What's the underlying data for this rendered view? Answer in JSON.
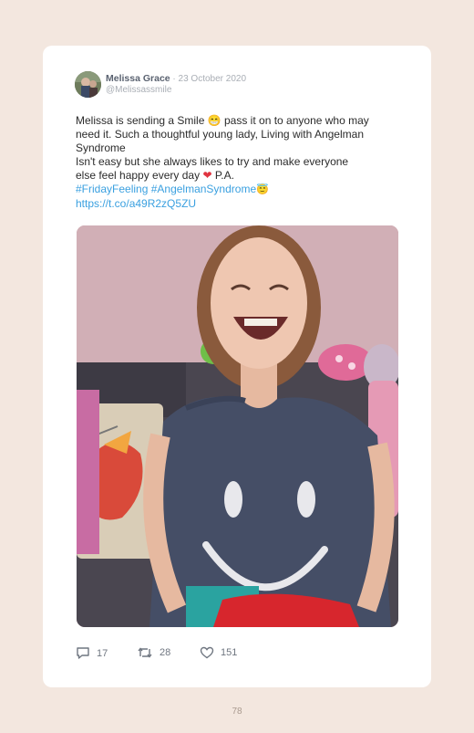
{
  "tweet": {
    "author_name": "Melissa Grace",
    "separator": " · ",
    "date": "23 October 2020",
    "handle": "@Melissassmile",
    "text_lines": [
      "Melissa is sending a Smile 😁 pass it on to anyone who may",
      "need it. Such a thoughtful young lady, Living with Angelman",
      "Syndrome",
      "Isn't easy but she always likes to try and make everyone",
      "else feel happy every day"
    ],
    "heart_emoji": "❤",
    "signature": " P.A.",
    "hashtag_1": "#FridayFeeling",
    "hashtag_2": "#AngelmanSyndrome",
    "hashtag_emoji": "😇",
    "link": "https://t.co/a49R2zQ5ZU"
  },
  "actions": {
    "replies": "17",
    "retweets": "28",
    "likes": "151",
    "reply_icon": "speech-bubble-icon",
    "retweet_icon": "retweet-arrows-icon",
    "like_icon": "heart-outline-icon"
  },
  "page": {
    "number": "78"
  },
  "colors": {
    "background": "#f3e7df",
    "card": "#ffffff",
    "link": "#3aa0e0",
    "text": "#2b2b2b",
    "muted": "#a9aeb5"
  }
}
